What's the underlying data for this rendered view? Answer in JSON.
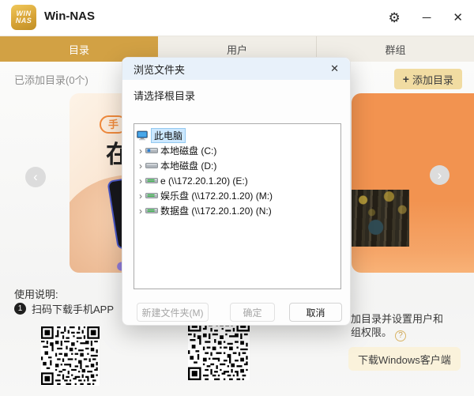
{
  "window": {
    "title": "Win-NAS",
    "logo_top": "WIN",
    "logo_bottom": "NAS"
  },
  "icons": {
    "gear": "⚙",
    "minimize": "─",
    "close": "✕",
    "dialog_close": "✕",
    "chevron_left": "‹",
    "chevron_right": "›",
    "tree_expand": "›",
    "help": "?",
    "plus": "+"
  },
  "tabs": [
    {
      "label": "目录",
      "active": true
    },
    {
      "label": "用户",
      "active": false
    },
    {
      "label": "群组",
      "active": false
    }
  ],
  "directory_section": {
    "added_count": "已添加目录(0个)",
    "add_button": "添加目录"
  },
  "carousel": {
    "left_badge": "手",
    "left_char": "在"
  },
  "dialog": {
    "title": "浏览文件夹",
    "prompt": "请选择根目录",
    "tree": {
      "root": "此电脑",
      "items": [
        {
          "label": "本地磁盘 (C:)"
        },
        {
          "label": "本地磁盘 (D:)"
        },
        {
          "label": "e (\\\\172.20.1.20) (E:)"
        },
        {
          "label": "娱乐盘 (\\\\172.20.1.20) (M:)"
        },
        {
          "label": "数据盘 (\\\\172.20.1.20) (N:)"
        }
      ]
    },
    "buttons": {
      "new_folder": "新建文件夹(M)",
      "ok": "确定",
      "cancel": "取消"
    }
  },
  "instructions": {
    "heading": "使用说明:",
    "step_number": "1",
    "step_text": "扫码下载手机APP"
  },
  "note": {
    "line1": "加目录并设置用户和",
    "line2": "组权限。"
  },
  "download": {
    "label": "下载Windows客户端"
  },
  "colors": {
    "accent_gold": "#d2a144",
    "tab_inactive": "#f1eee7",
    "selection_blue": "#cce8ff",
    "add_button_tan": "#f1dca2",
    "download_cream": "#faf2db",
    "dialog_header_blue": "#e8f1fa",
    "card_orange": "#f29350"
  }
}
